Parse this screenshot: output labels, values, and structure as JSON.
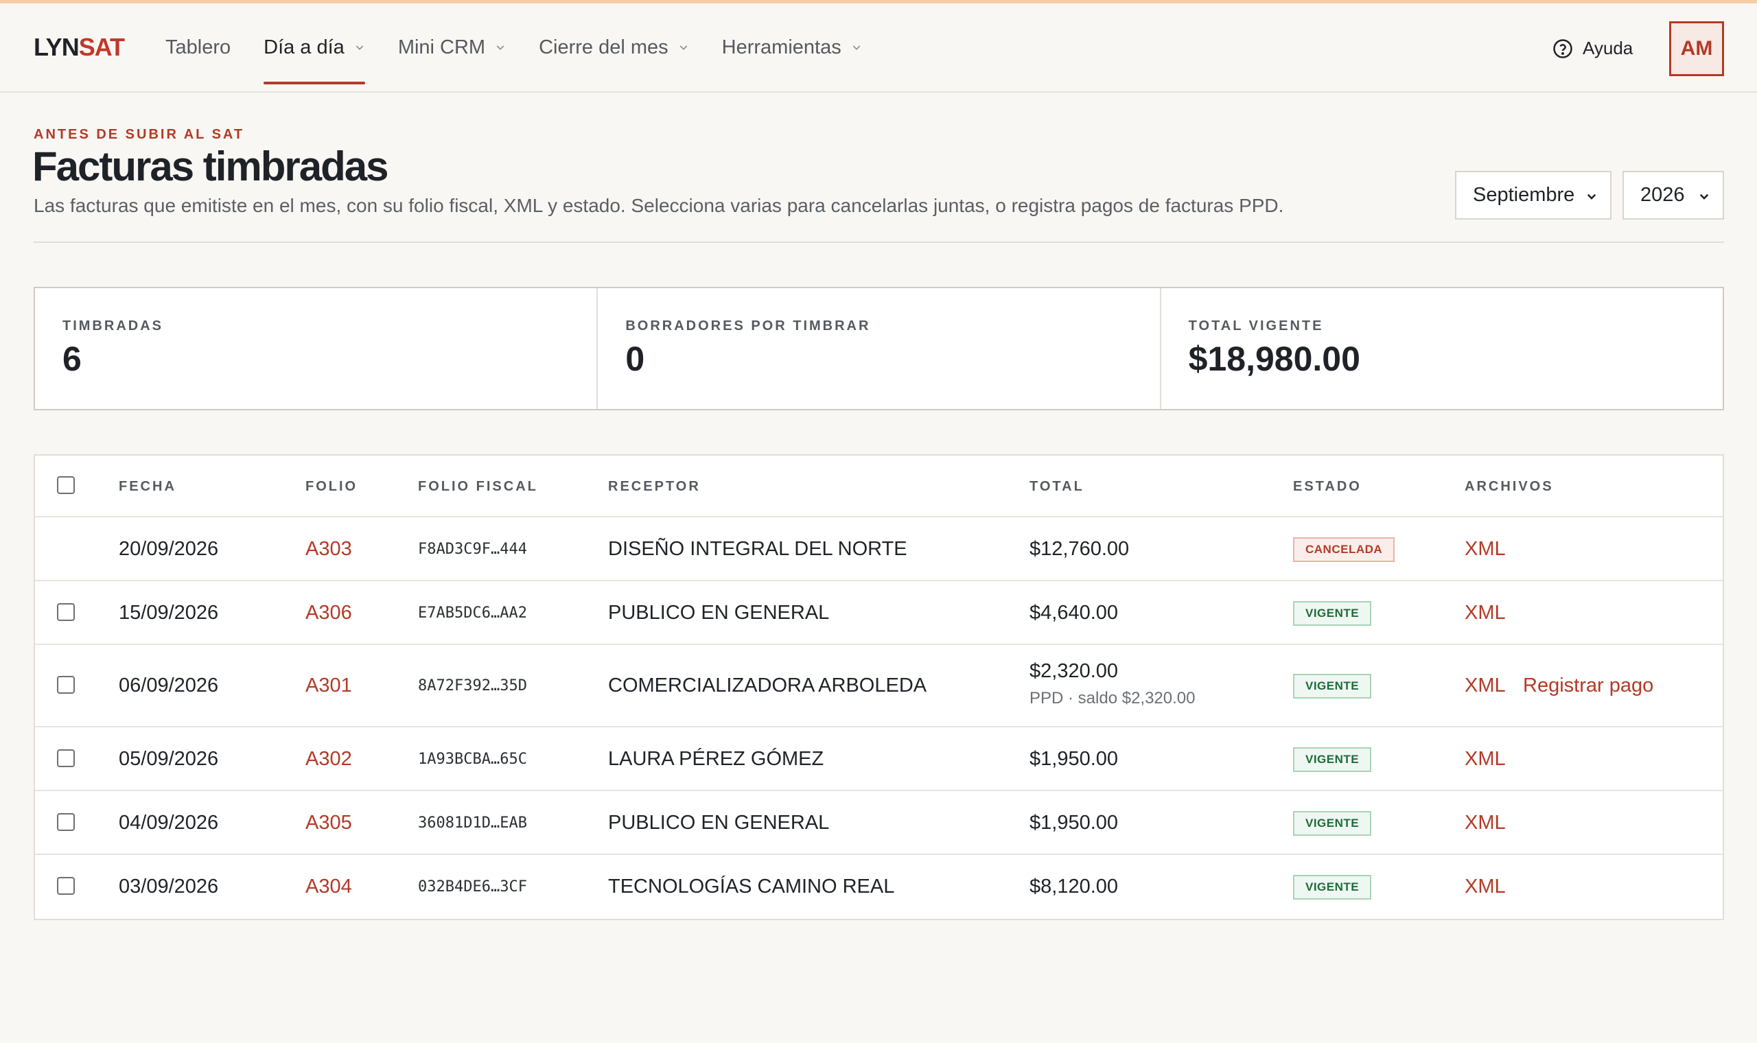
{
  "colors": {
    "accent": "#b33a27",
    "vigente": "#1e6b3a",
    "cancelada": "#b33a27",
    "background": "#f9f7f3"
  },
  "nav": {
    "logo_part1": "LYN",
    "logo_part2": "SAT",
    "items": [
      {
        "label": "Tablero",
        "dropdown": false,
        "active": false
      },
      {
        "label": "Día a día",
        "dropdown": true,
        "active": true
      },
      {
        "label": "Mini CRM",
        "dropdown": true,
        "active": false
      },
      {
        "label": "Cierre del mes",
        "dropdown": true,
        "active": false
      },
      {
        "label": "Herramientas",
        "dropdown": true,
        "active": false
      }
    ],
    "help_label": "Ayuda",
    "help_icon": "question-circle-icon",
    "avatar_initials": "AM"
  },
  "page": {
    "eyebrow": "ANTES DE SUBIR AL SAT",
    "title": "Facturas timbradas",
    "subtitle": "Las facturas que emitiste en el mes, con su folio fiscal, XML y estado. Selecciona varias para cancelarlas juntas, o registra pagos de facturas PPD.",
    "month_select": "Septiembre",
    "year_select": "2026"
  },
  "stats": [
    {
      "label": "TIMBRADAS",
      "value": "6"
    },
    {
      "label": "BORRADORES POR TIMBRAR",
      "value": "0"
    },
    {
      "label": "TOTAL VIGENTE",
      "value": "$18,980.00"
    }
  ],
  "table": {
    "headers": [
      "FECHA",
      "FOLIO",
      "FOLIO FISCAL",
      "RECEPTOR",
      "TOTAL",
      "ESTADO",
      "ARCHIVOS"
    ],
    "rows": [
      {
        "checkbox": false,
        "fecha": "20/09/2026",
        "folio": "A303",
        "folio_fiscal": "F8AD3C9F…444",
        "receptor": "DISEÑO INTEGRAL DEL NORTE",
        "total": "$12,760.00",
        "total_sub": "",
        "estado": "CANCELADA",
        "estado_type": "red",
        "xml": "XML",
        "extra": ""
      },
      {
        "checkbox": true,
        "fecha": "15/09/2026",
        "folio": "A306",
        "folio_fiscal": "E7AB5DC6…AA2",
        "receptor": "PUBLICO EN GENERAL",
        "total": "$4,640.00",
        "total_sub": "",
        "estado": "VIGENTE",
        "estado_type": "green",
        "xml": "XML",
        "extra": ""
      },
      {
        "checkbox": true,
        "fecha": "06/09/2026",
        "folio": "A301",
        "folio_fiscal": "8A72F392…35D",
        "receptor": "COMERCIALIZADORA ARBOLEDA",
        "total": "$2,320.00",
        "total_sub": "PPD · saldo $2,320.00",
        "estado": "VIGENTE",
        "estado_type": "green",
        "xml": "XML",
        "extra": "Registrar pago"
      },
      {
        "checkbox": true,
        "fecha": "05/09/2026",
        "folio": "A302",
        "folio_fiscal": "1A93BCBA…65C",
        "receptor": "LAURA PÉREZ GÓMEZ",
        "total": "$1,950.00",
        "total_sub": "",
        "estado": "VIGENTE",
        "estado_type": "green",
        "xml": "XML",
        "extra": ""
      },
      {
        "checkbox": true,
        "fecha": "04/09/2026",
        "folio": "A305",
        "folio_fiscal": "36081D1D…EAB",
        "receptor": "PUBLICO EN GENERAL",
        "total": "$1,950.00",
        "total_sub": "",
        "estado": "VIGENTE",
        "estado_type": "green",
        "xml": "XML",
        "extra": ""
      },
      {
        "checkbox": true,
        "fecha": "03/09/2026",
        "folio": "A304",
        "folio_fiscal": "032B4DE6…3CF",
        "receptor": "TECNOLOGÍAS CAMINO REAL",
        "total": "$8,120.00",
        "total_sub": "",
        "estado": "VIGENTE",
        "estado_type": "green",
        "xml": "XML",
        "extra": ""
      }
    ]
  }
}
